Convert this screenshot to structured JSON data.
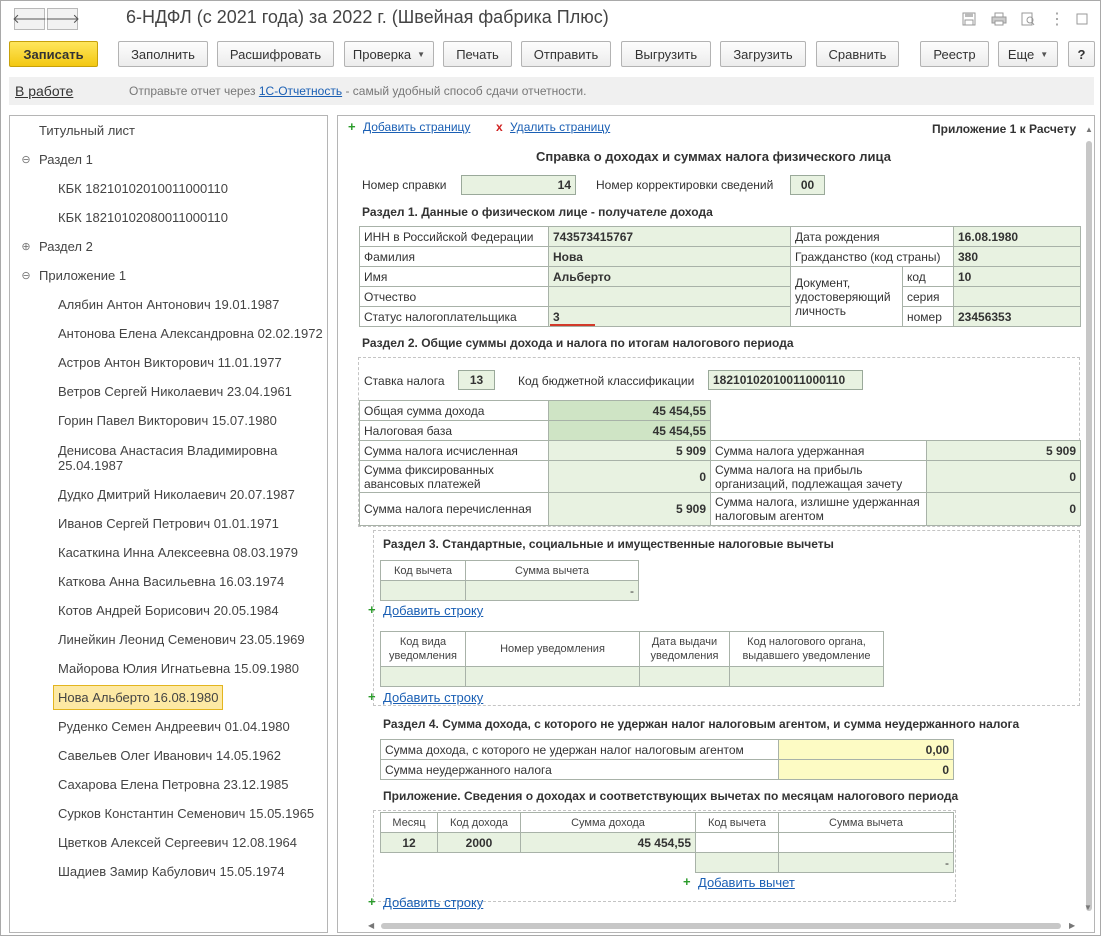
{
  "window": {
    "title": "6-НДФЛ (с 2021 года) за 2022 г. (Швейная фабрика Плюс)",
    "back_icon": "arrow-left-icon",
    "forward_icon": "arrow-right-icon"
  },
  "toolbar": {
    "save": "Записать",
    "fill": "Заполнить",
    "decode": "Расшифровать",
    "check": "Проверка",
    "print": "Печать",
    "send": "Отправить",
    "export": "Выгрузить",
    "import": "Загрузить",
    "compare": "Сравнить",
    "registry": "Реестр",
    "more": "Еще",
    "help": "?"
  },
  "infobar": {
    "status": "В работе",
    "hint_before": "Отправьте отчет через",
    "hint_link": "1С-Отчетность",
    "hint_after": "- самый удобный способ сдачи отчетности."
  },
  "tree": {
    "items": [
      {
        "label": "Титульный лист"
      },
      {
        "label": "Раздел 1",
        "toggle": "⊖"
      },
      {
        "label": "КБК 18210102010011000110"
      },
      {
        "label": "КБК 18210102080011000110"
      },
      {
        "label": "Раздел 2",
        "toggle": "⊕"
      },
      {
        "label": "Приложение 1",
        "toggle": "⊖"
      },
      {
        "label": "Алябин Антон Антонович 19.01.1987"
      },
      {
        "label": "Антонова Елена Александровна 02.02.1972"
      },
      {
        "label": "Астров Антон Викторович 11.01.1977"
      },
      {
        "label": "Ветров Сергей Николаевич 23.04.1961"
      },
      {
        "label": "Горин Павел Викторович 15.07.1980"
      },
      {
        "label": "Денисова Анастасия Владимировна 25.04.1987"
      },
      {
        "label": "Дудко Дмитрий Николаевич 20.07.1987"
      },
      {
        "label": "Иванов Сергей Петрович 01.01.1971"
      },
      {
        "label": "Касаткина Инна Алексеевна 08.03.1979"
      },
      {
        "label": "Каткова Анна Васильевна 16.03.1974"
      },
      {
        "label": "Котов Андрей Борисович 20.05.1984"
      },
      {
        "label": "Линейкин Леонид Семенович 23.05.1969"
      },
      {
        "label": "Майорова Юлия Игнатьевна 15.09.1980"
      },
      {
        "label": "Нова Альберто 16.08.1980"
      },
      {
        "label": "Руденко Семен Андреевич 01.04.1980"
      },
      {
        "label": "Савельев Олег Иванович 14.05.1962"
      },
      {
        "label": "Сахарова Елена Петровна 23.12.1985"
      },
      {
        "label": "Сурков Константин Семенович 15.05.1965"
      },
      {
        "label": "Цветков Алексей Сергеевич 12.08.1964"
      },
      {
        "label": "Шадиев Замир Кабулович 15.05.1974"
      }
    ]
  },
  "form": {
    "add_page": "Добавить страницу",
    "delete_page": "Удалить страницу",
    "appendix": "Приложение 1 к Расчету",
    "heading": "Справка о доходах и суммах налога физического лица",
    "cert_no_label": "Номер справки",
    "cert_no": "14",
    "corr_label": "Номер корректировки сведений",
    "corr_no": "00",
    "s1": {
      "title": "Раздел 1. Данные о физическом лице - получателе дохода",
      "inn_label": "ИНН в Российской Федерации",
      "inn": "743573415767",
      "surname_label": "Фамилия",
      "surname": "Нова",
      "name_label": "Имя",
      "name": "Альберто",
      "patronymic_label": "Отчество",
      "patronymic": "",
      "status_label": "Статус налогоплательщика",
      "status": "3",
      "birth_label": "Дата рождения",
      "birth": "16.08.1980",
      "citizenship_label": "Гражданство (код страны)",
      "citizenship": "380",
      "doc_label": "Документ, удостоверяющий личность",
      "code_label": "код",
      "code": "10",
      "series_label": "серия",
      "series": "",
      "number_label": "номер",
      "number": "23456353"
    },
    "s2": {
      "title": "Раздел 2. Общие суммы дохода и налога по итогам налогового периода",
      "rate_label": "Ставка налога",
      "rate": "13",
      "kbk_label": "Код бюджетной классификации",
      "kbk": "18210102010011000110",
      "total_income_label": "Общая сумма дохода",
      "total_income": "45 454,55",
      "tax_base_label": "Налоговая база",
      "tax_base": "45 454,55",
      "tax_calc_label": "Сумма налога исчисленная",
      "tax_calc": "5 909",
      "fixed_adv_label": "Сумма фиксированных авансовых платежей",
      "fixed_adv": "0",
      "tax_paid_label": "Сумма налога перечисленная",
      "tax_paid": "5 909",
      "tax_withheld_label": "Сумма налога удержанная",
      "tax_withheld": "5 909",
      "profit_tax_label": "Сумма налога на прибыль организаций, подлежащая зачету",
      "profit_tax": "0",
      "excess_label": "Сумма налога, излишне удержанная налоговым агентом",
      "excess": "0"
    },
    "s3": {
      "title": "Раздел 3. Стандартные, социальные и имущественные налоговые вычеты",
      "col_code": "Код вычета",
      "col_sum": "Сумма вычета",
      "row_sum": "-",
      "add_row": "Добавить строку",
      "n_col_type": "Код вида уведомления",
      "n_col_num": "Номер уведомления",
      "n_col_date": "Дата выдачи уведомления",
      "n_col_org": "Код налогового органа, выдавшего уведомление",
      "add_row2": "Добавить строку"
    },
    "s4": {
      "title": "Раздел 4. Сумма дохода, с которого не удержан налог налоговым агентом, и сумма неудержанного налога",
      "income_label": "Сумма дохода, с которого не удержан налог налоговым агентом",
      "income": "0,00",
      "tax_label": "Сумма неудержанного налога",
      "tax": "0"
    },
    "app": {
      "title": "Приложение. Сведения о доходах и соответствующих вычетах по месяцам налогового периода",
      "col_month": "Месяц",
      "col_code": "Код дохода",
      "col_sum": "Сумма дохода",
      "col_ded_code": "Код вычета",
      "col_ded_sum": "Сумма вычета",
      "rows": [
        {
          "month": "12",
          "code": "2000",
          "sum": "45 454,55",
          "ded_sum": "-"
        }
      ],
      "add_deduction": "Добавить вычет",
      "add_row": "Добавить строку"
    }
  }
}
